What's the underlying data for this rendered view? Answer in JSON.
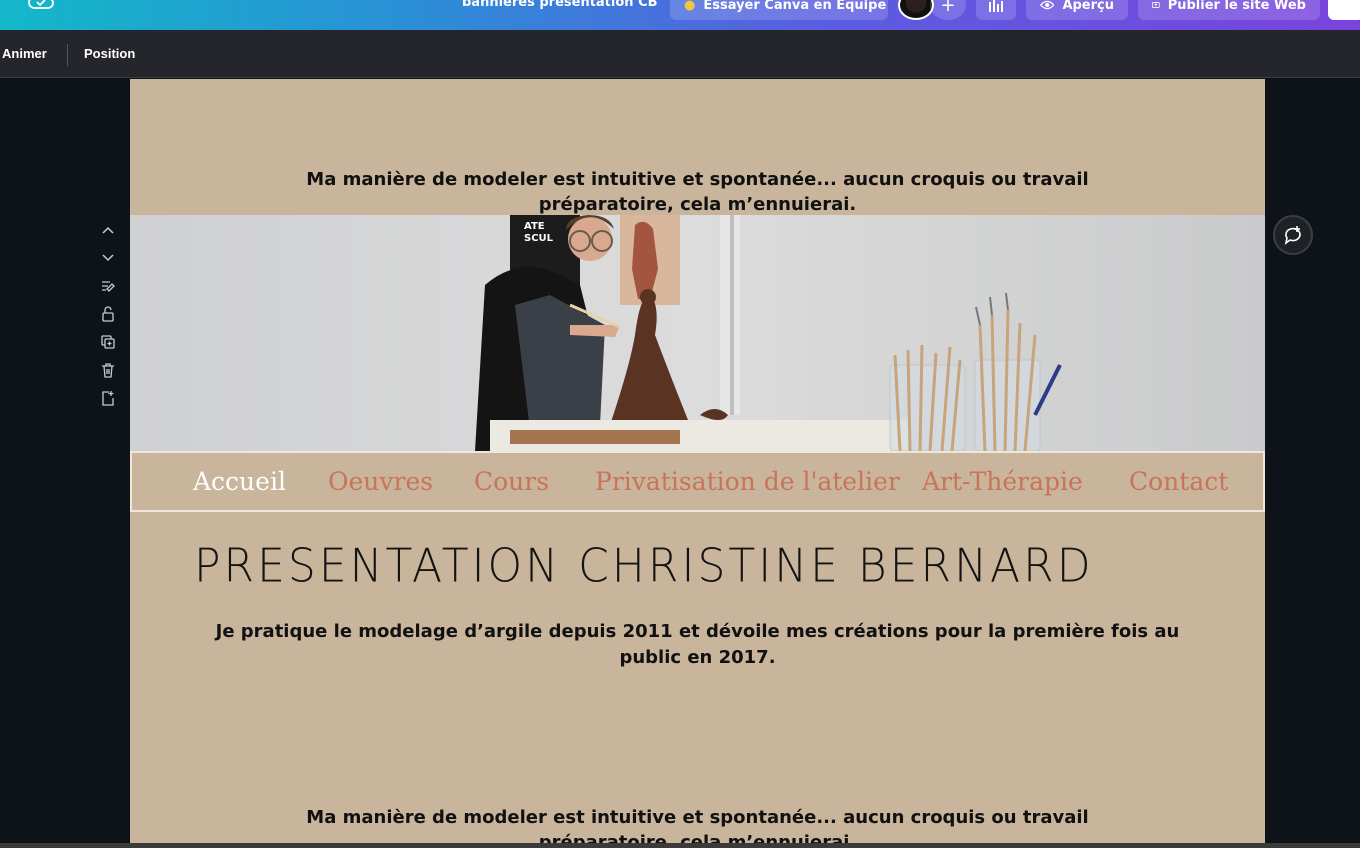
{
  "topbar": {
    "doc_title": "bannières présentation CB",
    "team_button": "Essayer Canva en Équipe",
    "add_label": "+",
    "preview_button": "Aperçu",
    "publish_button": "Publier le site Web"
  },
  "subbar": {
    "animate_label": "Animer",
    "position_label": "Position"
  },
  "page": {
    "quote_top": "Ma manière de modeler est intuitive et spontanée... aucun croquis ou travail préparatoire, cela m’ennuierai.",
    "nav": [
      "Accueil",
      "Oeuvres",
      "Cours",
      "Privatisation de l'atelier",
      "Art-Thérapie",
      "Contact"
    ],
    "heading": "PRESENTATION CHRISTINE BERNARD",
    "paragraph": "Je pratique le modelage d’argile depuis 2011 et dévoile mes créations pour la première fois au public en 2017.",
    "quote_bottom": "Ma manière de modeler est intuitive et spontanée... aucun croquis ou travail préparatoire, cela m’ennuierai.",
    "photo_poster_text": "ATE SCUL"
  },
  "colors": {
    "page_bg": "#c9b59c",
    "nav_link": "#c8735a",
    "nav_active": "#ffffff",
    "workspace_bg": "#0e1319"
  }
}
